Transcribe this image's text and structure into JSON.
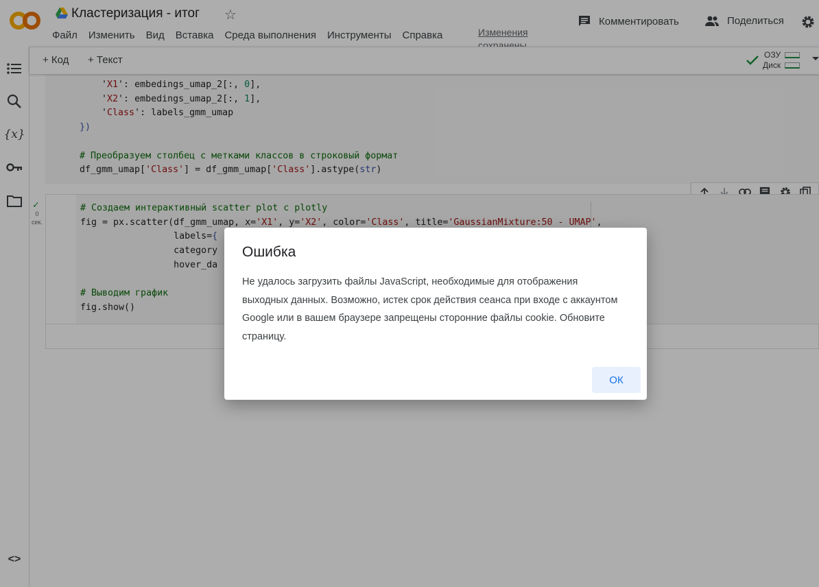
{
  "header": {
    "title": "Кластеризация - итог",
    "menu": [
      "Файл",
      "Изменить",
      "Вид",
      "Вставка",
      "Среда выполнения",
      "Инструменты",
      "Справка"
    ],
    "save_status": "Изменения сохранены",
    "comment_label": "Комментировать",
    "share_label": "Поделиться"
  },
  "toolbar": {
    "add_code": "+ Код",
    "add_text": "+ Текст",
    "ram_label": "ОЗУ",
    "disk_label": "Диск"
  },
  "cell1": {
    "lines": {
      "l1a": "    '",
      "l1b": "X1",
      "l1c": "': embedings_umap_2[:, ",
      "l1d": "0",
      "l1e": "],",
      "l2a": "    '",
      "l2b": "X2",
      "l2c": "': embedings_umap_2[:, ",
      "l2d": "1",
      "l2e": "],",
      "l3a": "    '",
      "l3b": "Class",
      "l3c": "': labels_gmm_umap",
      "l4": "})",
      "l5": "# Преобразуем столбец с метками классов в строковый формат",
      "l6a": "df_gmm_umap[",
      "l6b": "'Class'",
      "l6c": "] = df_gmm_umap[",
      "l6d": "'Class'",
      "l6e": "].astype(",
      "l6f": "str",
      "l6g": ")"
    }
  },
  "cell2": {
    "exec_time_value": "0",
    "exec_time_unit": "сек.",
    "lines": {
      "l1": "# Создаем интерактивный scatter plot с plotly",
      "l2a": "fig = px.scatter(df_gmm_umap, x=",
      "l2b": "'X1'",
      "l2c": ", y=",
      "l2d": "'X2'",
      "l2e": ", color=",
      "l2f": "'Class'",
      "l2g": ", title=",
      "l2h": "'GaussianMixture:50 - UMAP'",
      "l2i": ",",
      "l3a": "                 labels=",
      "l3b": "{",
      "l4": "                 category",
      "l5": "                 hover_da",
      "l6": "# Выводим график",
      "l7": "fig.show()"
    }
  },
  "dialog": {
    "title": "Ошибка",
    "message": "Не удалось загрузить файлы JavaScript, необходимые для отображения выходных данных. Возможно, истек срок действия сеанса при входе с аккаунтом Google или в вашем браузере запрещены сторонние файлы cookie. Обновите страницу.",
    "ok_label": "ОК"
  }
}
